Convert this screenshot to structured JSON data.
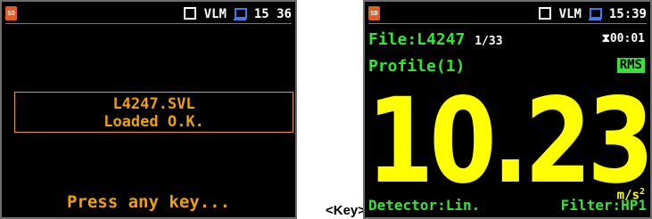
{
  "left_screen": {
    "sd_icon": "SD",
    "status_label": "VLM",
    "time": "15 36",
    "message_line1": "L4247.SVL",
    "message_line2": "Loaded O.K.",
    "prompt": "Press any key..."
  },
  "transition_label": "<Key>",
  "right_screen": {
    "sd_icon": "SD",
    "status_label": "VLM",
    "time": "15:39",
    "file_label": "File:L4247",
    "file_count": "1/33",
    "timer_symbol": "⧗",
    "timer": "00:01",
    "profile": "Profile(1)",
    "rms_badge": "RMS",
    "reading": "10.23",
    "unit": "m/s",
    "unit_exp": "2",
    "detector": "Detector:Lin.",
    "filter": "Filter:HP1"
  },
  "colors": {
    "orange": "#f0a000",
    "green": "#32e632",
    "yellow": "#ffff00",
    "blue": "#3c7cf0"
  }
}
